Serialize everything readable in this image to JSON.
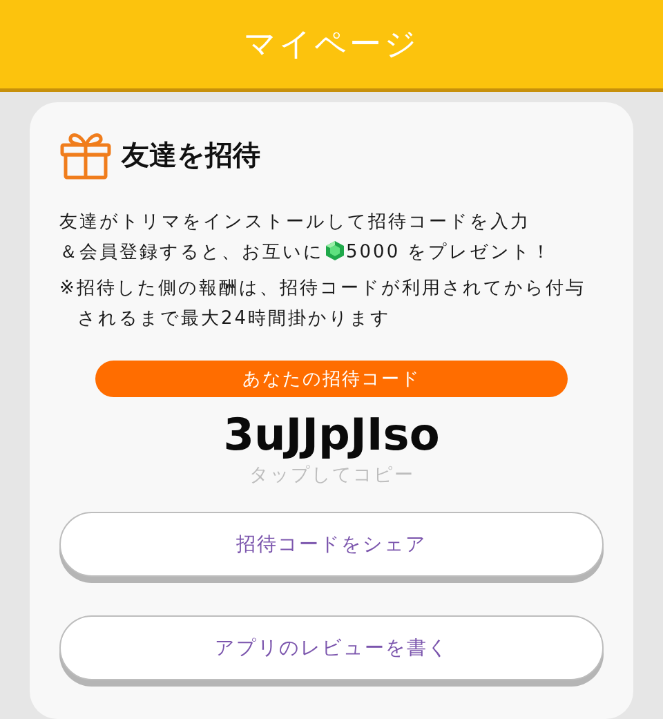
{
  "header": {
    "title": "マイページ"
  },
  "invite_card": {
    "title": "友達を招待",
    "description": {
      "line1": "友達がトリマをインストールして招待コードを入力",
      "line2_before": "＆会員登録すると、お互いに",
      "line2_after": "5000 をプレゼント！"
    },
    "note": "※招待した側の報酬は、招待コードが利用されてから付与されるまで最大24時間掛かります",
    "code_label": "あなたの招待コード",
    "code": "3uJJpJIso",
    "copy_hint": "タップしてコピー",
    "buttons": [
      "招待コードをシェア",
      "アプリのレビューを書く"
    ]
  }
}
